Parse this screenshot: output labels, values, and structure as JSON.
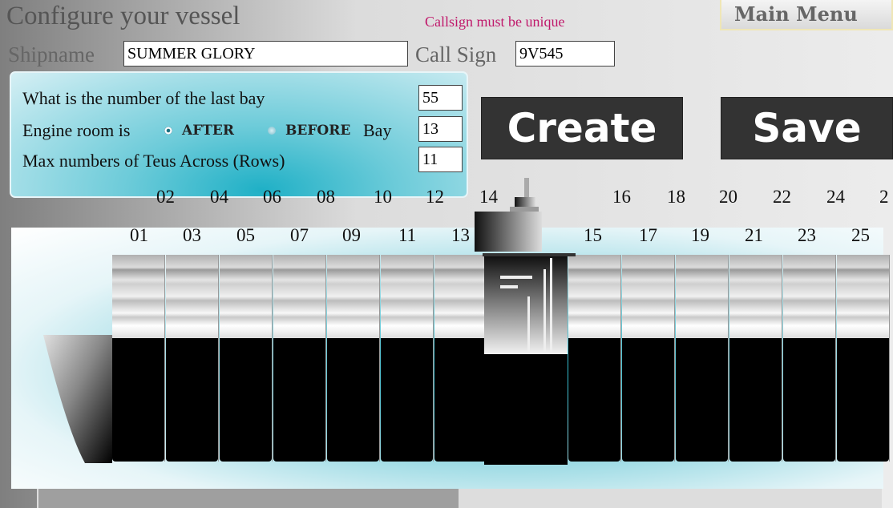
{
  "header": {
    "title": "Configure your vessel",
    "warning": "Callsign must be unique",
    "main_menu_label": "Main Menu"
  },
  "form": {
    "shipname_label": "Shipname",
    "shipname_value": "SUMMER GLORY",
    "callsign_label": "Call Sign",
    "callsign_value": "9V545"
  },
  "config": {
    "last_bay_label": "What is the number of the last bay",
    "last_bay_value": "55",
    "engine_label": "Engine room is",
    "after_label": "AFTER",
    "before_label": "BEFORE",
    "bay_label": "Bay",
    "engine_bay_value": "13",
    "engine_position_selected": "AFTER",
    "rows_label": "Max numbers of Teus Across (Rows)",
    "rows_value": "11"
  },
  "buttons": {
    "create_label": "Create",
    "save_label": "Save"
  },
  "bays": {
    "even": [
      "02",
      "04",
      "06",
      "08",
      "10",
      "12",
      "14",
      "16",
      "18",
      "20",
      "22",
      "24",
      "2"
    ],
    "odd": [
      "01",
      "03",
      "05",
      "07",
      "09",
      "11",
      "13",
      "15",
      "17",
      "19",
      "21",
      "23",
      "25"
    ]
  },
  "colors": {
    "accent": "#1fb0c6",
    "warning": "#c0186b",
    "button_bg": "#333333"
  }
}
